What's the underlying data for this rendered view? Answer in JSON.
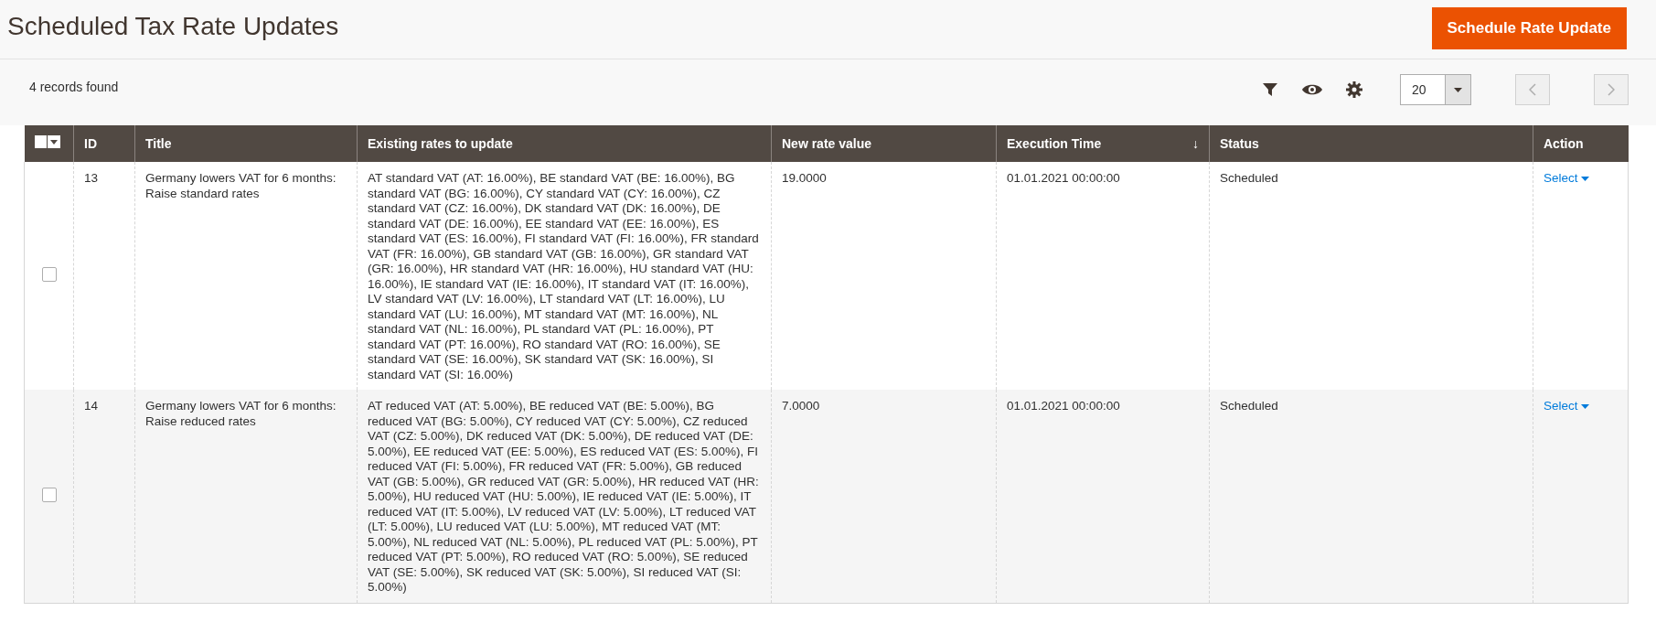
{
  "page_title": "Scheduled Tax Rate Updates",
  "primary_button": "Schedule Rate Update",
  "records_found": "4 records found",
  "per_page": "20",
  "table": {
    "select_all": {
      "checked": false
    },
    "columns": [
      {
        "label": "ID"
      },
      {
        "label": "Title"
      },
      {
        "label": "Existing rates to update"
      },
      {
        "label": "New rate value"
      },
      {
        "label": "Execution Time",
        "sort_indicator": "↓"
      },
      {
        "label": "Status"
      },
      {
        "label": "Action"
      }
    ],
    "rows": [
      {
        "checked": false,
        "id": "13",
        "title": "Germany lowers VAT for 6 months: Raise standard rates",
        "rates": "AT standard VAT (AT: 16.00%), BE standard VAT (BE: 16.00%), BG standard VAT (BG: 16.00%), CY standard VAT (CY: 16.00%), CZ standard VAT (CZ: 16.00%), DK standard VAT (DK: 16.00%), DE standard VAT (DE: 16.00%), EE standard VAT (EE: 16.00%), ES standard VAT (ES: 16.00%), FI standard VAT (FI: 16.00%), FR standard VAT (FR: 16.00%), GB standard VAT (GB: 16.00%), GR standard VAT (GR: 16.00%), HR standard VAT (HR: 16.00%), HU standard VAT (HU: 16.00%), IE standard VAT (IE: 16.00%), IT standard VAT (IT: 16.00%), LV standard VAT (LV: 16.00%), LT standard VAT (LT: 16.00%), LU standard VAT (LU: 16.00%), MT standard VAT (MT: 16.00%), NL standard VAT (NL: 16.00%), PL standard VAT (PL: 16.00%), PT standard VAT (PT: 16.00%), RO standard VAT (RO: 16.00%), SE standard VAT (SE: 16.00%), SK standard VAT (SK: 16.00%), SI standard VAT (SI: 16.00%)",
        "new_rate": "19.0000",
        "execution_time": "01.01.2021 00:00:00",
        "status": "Scheduled",
        "action": "Select"
      },
      {
        "checked": false,
        "id": "14",
        "title": "Germany lowers VAT for 6 months: Raise reduced rates",
        "rates": "AT reduced VAT (AT: 5.00%), BE reduced VAT (BE: 5.00%), BG reduced VAT (BG: 5.00%), CY reduced VAT (CY: 5.00%), CZ reduced VAT (CZ: 5.00%), DK reduced VAT (DK: 5.00%), DE reduced VAT (DE: 5.00%), EE reduced VAT (EE: 5.00%), ES reduced VAT (ES: 5.00%), FI reduced VAT (FI: 5.00%), FR reduced VAT (FR: 5.00%), GB reduced VAT (GB: 5.00%), GR reduced VAT (GR: 5.00%), HR reduced VAT (HR: 5.00%), HU reduced VAT (HU: 5.00%), IE reduced VAT (IE: 5.00%), IT reduced VAT (IT: 5.00%), LV reduced VAT (LV: 5.00%), LT reduced VAT (LT: 5.00%), LU reduced VAT (LU: 5.00%), MT reduced VAT (MT: 5.00%), NL reduced VAT (NL: 5.00%), PL reduced VAT (PL: 5.00%), PT reduced VAT (PT: 5.00%), RO reduced VAT (RO: 5.00%), SE reduced VAT (SE: 5.00%), SK reduced VAT (SK: 5.00%), SI reduced VAT (SI: 5.00%)",
        "new_rate": "7.0000",
        "execution_time": "01.01.2021 00:00:00",
        "status": "Scheduled",
        "action": "Select"
      }
    ]
  }
}
